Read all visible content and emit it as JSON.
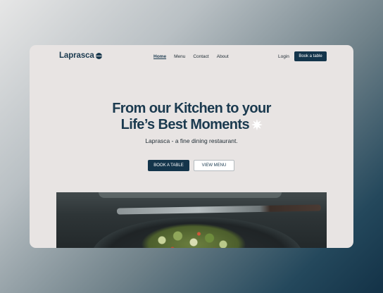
{
  "brand": {
    "name": "Laprasca"
  },
  "nav": {
    "items": [
      {
        "label": "Home",
        "active": true
      },
      {
        "label": "Menu",
        "active": false
      },
      {
        "label": "Contact",
        "active": false
      },
      {
        "label": "About",
        "active": false
      }
    ],
    "login_label": "Login",
    "book_label": "Book a table"
  },
  "hero": {
    "title_line1": "From our Kitchen to your",
    "title_line2": "Life’s Best Moments",
    "sparkle_icon": "sparkle-icon",
    "subtitle": "Laprasca - a fine dining restaurant.",
    "primary_cta": "BOOK A TABLE",
    "secondary_cta": "VIEW MENU"
  },
  "colors": {
    "primary": "#14354b",
    "page_bg": "#e8e4e3"
  }
}
